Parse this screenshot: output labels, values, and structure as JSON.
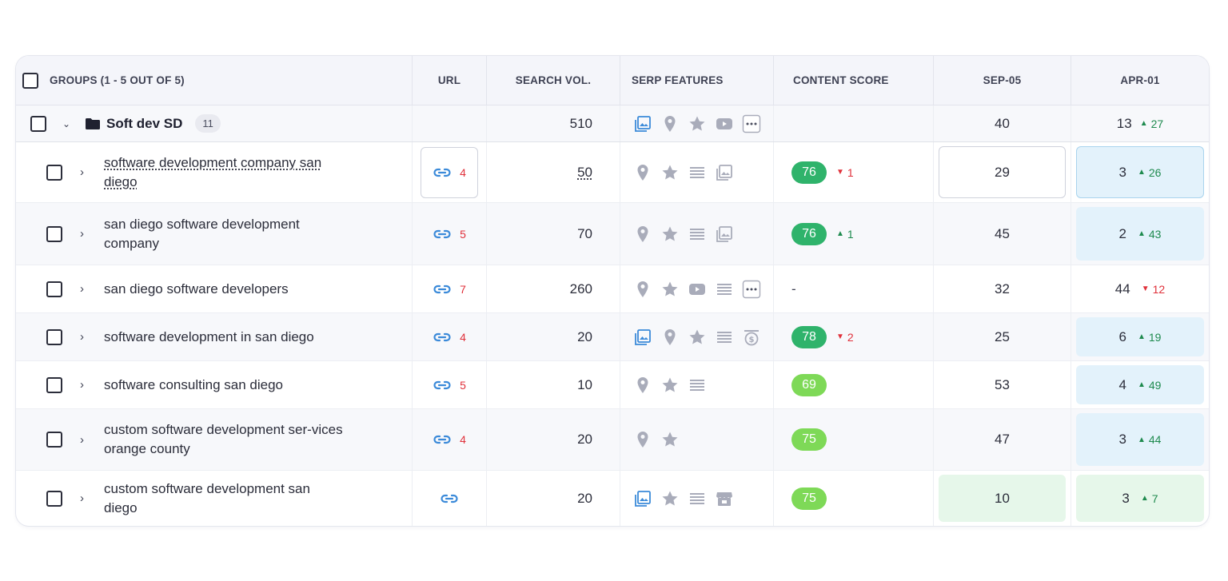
{
  "header": {
    "groups_label": "GROUPS (1 - 5 OUT OF 5)",
    "url_label": "URL",
    "search_vol_label": "SEARCH VOL.",
    "serp_label": "SERP FEATURES",
    "content_score_label": "CONTENT SCORE",
    "sep_label": "SEP-05",
    "apr_label": "APR-01"
  },
  "group": {
    "name": "Soft dev SD",
    "count": "11",
    "search_vol": "510",
    "sep": "40",
    "apr_rank": "13",
    "apr_delta": "27",
    "serp_icons": [
      "image-pack-icon",
      "location-pin-icon",
      "star-icon",
      "video-icon",
      "more-icon"
    ]
  },
  "colors": {
    "link_blue": "#3b8ad9",
    "score_dark_green": "#2fb36b",
    "score_light_green": "#7ed957",
    "rank_blue_bg": "#e3f2fb",
    "rank_green_bg": "#e6f7ea",
    "delta_up": "#1e8a4e",
    "delta_down": "#e0313b"
  },
  "rows": [
    {
      "keyword": "software development company san diego",
      "url_count": "4",
      "search_vol": "50",
      "serp_icons": [
        "location-pin-icon",
        "star-icon",
        "list-icon",
        "image-icon"
      ],
      "score": "76",
      "score_delta": "1",
      "score_dir": "down",
      "sep": "29",
      "apr_rank": "3",
      "apr_delta": "26",
      "apr_dir": "up"
    },
    {
      "keyword": "san diego software development company",
      "url_count": "5",
      "search_vol": "70",
      "serp_icons": [
        "location-pin-icon",
        "star-icon",
        "list-icon",
        "image-icon"
      ],
      "score": "76",
      "score_delta": "1",
      "score_dir": "up",
      "sep": "45",
      "apr_rank": "2",
      "apr_delta": "43",
      "apr_dir": "up"
    },
    {
      "keyword": "san diego software developers",
      "url_count": "7",
      "search_vol": "260",
      "serp_icons": [
        "location-pin-icon",
        "star-icon",
        "video-icon",
        "list-icon",
        "more-icon"
      ],
      "score": "-",
      "sep": "32",
      "apr_rank": "44",
      "apr_delta": "12",
      "apr_dir": "down"
    },
    {
      "keyword": "software development in san diego",
      "url_count": "4",
      "search_vol": "20",
      "serp_icons": [
        "image-pack-icon",
        "location-pin-icon",
        "star-icon",
        "list-icon",
        "ads-icon"
      ],
      "score": "78",
      "score_delta": "2",
      "score_dir": "down",
      "sep": "25",
      "apr_rank": "6",
      "apr_delta": "19",
      "apr_dir": "up"
    },
    {
      "keyword": "software consulting san diego",
      "url_count": "5",
      "search_vol": "10",
      "serp_icons": [
        "location-pin-icon",
        "star-icon",
        "list-icon"
      ],
      "score": "69",
      "sep": "53",
      "apr_rank": "4",
      "apr_delta": "49",
      "apr_dir": "up"
    },
    {
      "keyword": "custom software development ser-vices orange county",
      "url_count": "4",
      "search_vol": "20",
      "serp_icons": [
        "location-pin-icon",
        "star-icon"
      ],
      "score": "75",
      "sep": "47",
      "apr_rank": "3",
      "apr_delta": "44",
      "apr_dir": "up"
    },
    {
      "keyword": "custom software development san diego",
      "search_vol": "20",
      "serp_icons": [
        "image-pack-icon",
        "star-icon",
        "list-icon",
        "shop-icon"
      ],
      "score": "75",
      "sep": "10",
      "apr_rank": "3",
      "apr_delta": "7",
      "apr_dir": "up"
    }
  ]
}
